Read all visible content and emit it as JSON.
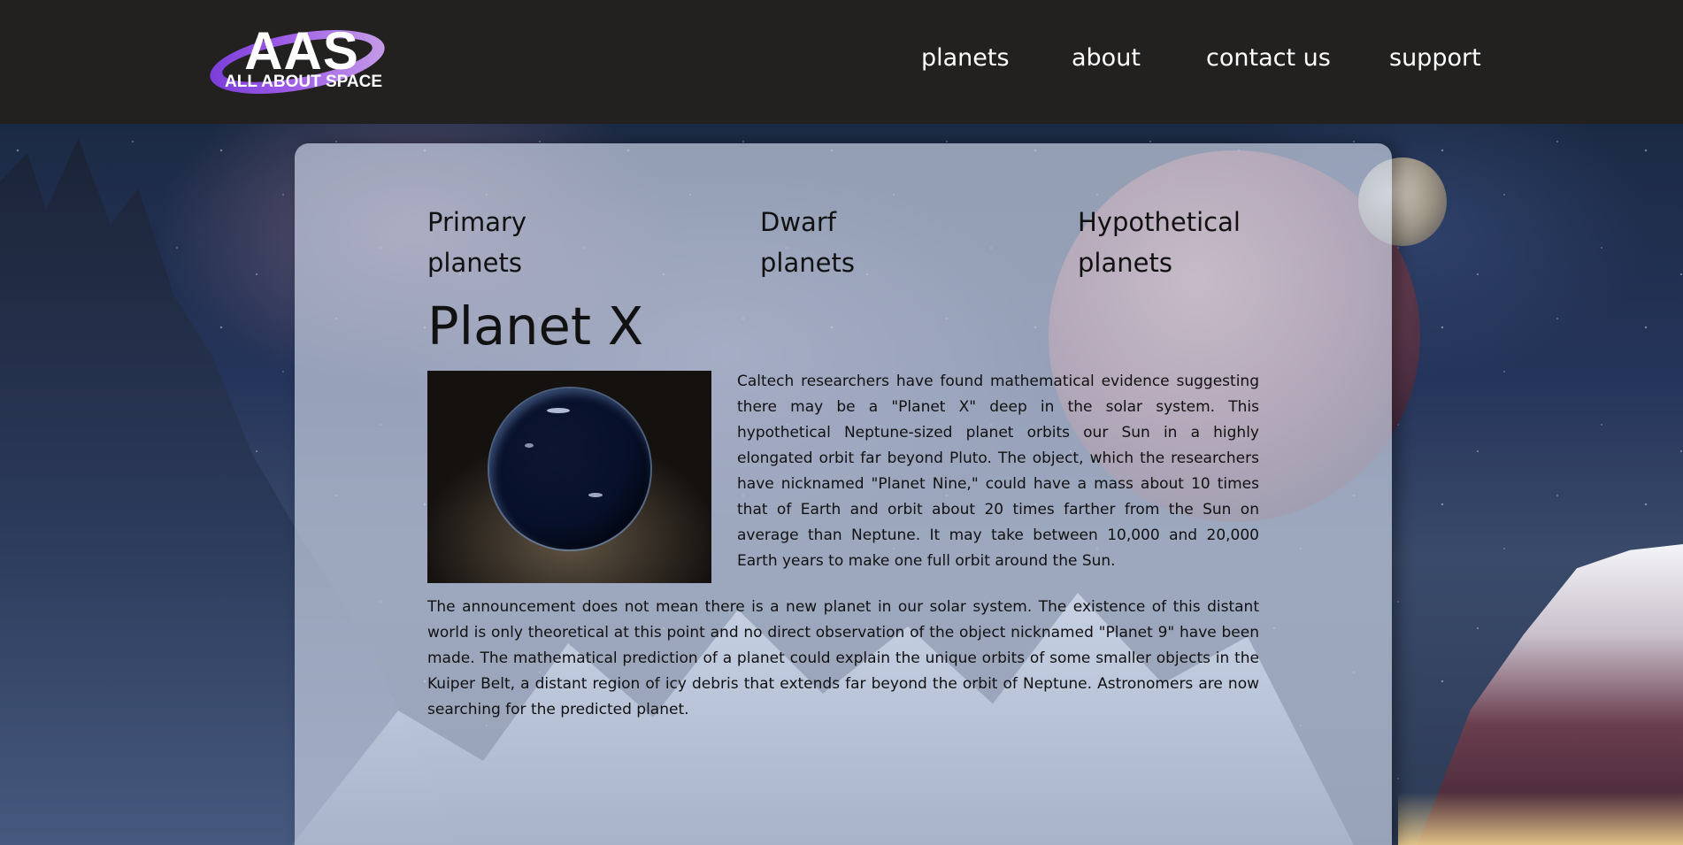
{
  "header": {
    "logo": {
      "big_text": "AAS",
      "small_text": "ALL ABOUT SPACE",
      "ring_colors": [
        "#7a3ed8",
        "#c69be8"
      ]
    },
    "nav": [
      {
        "label": "planets"
      },
      {
        "label": "about"
      },
      {
        "label": "contact us"
      },
      {
        "label": "support"
      }
    ],
    "background_color": "#222120"
  },
  "panel": {
    "categories": [
      {
        "label": "Primary planets"
      },
      {
        "label": "Dwarf planets"
      },
      {
        "label": "Hypothetical planets"
      }
    ],
    "title": "Planet X",
    "image_icon": "dark-blue-planet",
    "paragraph_1": "Caltech researchers have found mathematical evidence suggesting there may be a \"Planet X\" deep in the solar system. This hypothetical Neptune-sized planet orbits our Sun in a highly elongated orbit far beyond Pluto. The object, which the researchers have nicknamed \"Planet Nine,\" could have a mass about 10 times that of Earth and orbit about 20 times farther from the Sun on average than Neptune. It may take between 10,000 and 20,000 Earth years to make one full orbit around the Sun.",
    "paragraph_2": "The announcement does not mean there is a new planet in our solar system. The existence of this distant world is only theoretical at this point and no direct observation of the object nicknamed \"Planet 9\" have been made. The mathematical prediction of a planet could explain the unique orbits of some smaller objects in the Kuiper Belt, a distant region of icy debris that extends far beyond the orbit of Neptune. Astronomers are now searching for the predicted planet."
  }
}
